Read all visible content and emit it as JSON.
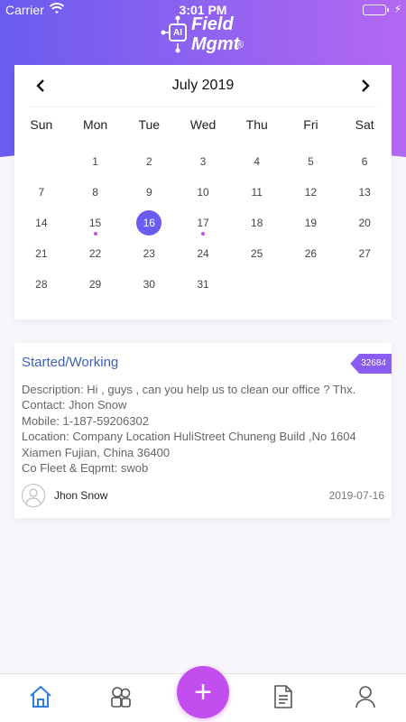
{
  "status_bar": {
    "carrier": "Carrier",
    "time": "3:01 PM"
  },
  "logo": {
    "ai": "AI",
    "field": "Field",
    "mgmt": "Mgmt",
    "reg": "®"
  },
  "calendar": {
    "month_title": "July  2019",
    "weekdays": [
      "Sun",
      "Mon",
      "Tue",
      "Wed",
      "Thu",
      "Fri",
      "Sat"
    ],
    "first_weekday": 1,
    "days_in_month": 31,
    "selected_day": 16,
    "event_days": [
      15,
      17
    ]
  },
  "job": {
    "status": "Started/Working",
    "tag": "32684",
    "description": "Description: Hi , guys , can you help us to clean our office ? Thx.",
    "contact": "Contact: Jhon Snow",
    "mobile": "Mobile: 1-187-59206302",
    "location_line1": "Location:  Company Location HuliStreet Chuneng Build ,No 1604",
    "location_line2": "Xiamen Fujian, China 36400",
    "fleet": "Co Fleet & Eqpmt: swob",
    "contact_name": "Jhon Snow",
    "date": "2019-07-16"
  },
  "colors": {
    "header_gradient_start": "#6a5cf0",
    "header_gradient_end": "#b468f2",
    "selected_day": "#6a5cf0",
    "event_dot": "#c34ef0",
    "fab": "#c34ef0",
    "status_text": "#3b5fb8",
    "active_tab": "#2f7de0"
  },
  "tab_bar": {
    "items": [
      {
        "icon": "home-icon",
        "active": true
      },
      {
        "icon": "team-icon",
        "active": false
      },
      {
        "icon": "plus-icon",
        "active": false
      },
      {
        "icon": "document-icon",
        "active": false
      },
      {
        "icon": "profile-icon",
        "active": false
      }
    ],
    "fab_label": "+"
  }
}
